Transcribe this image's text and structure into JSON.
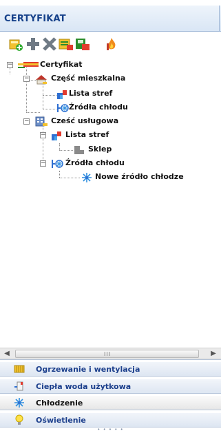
{
  "panel": {
    "title": "CERTYFIKAT"
  },
  "toolbar": {
    "buttons": [
      {
        "name": "add-item-icon"
      },
      {
        "name": "add-icon"
      },
      {
        "name": "delete-icon"
      },
      {
        "name": "edit-properties-icon"
      },
      {
        "name": "save-icon"
      },
      {
        "name": "fire-icon"
      }
    ]
  },
  "tree": {
    "root": "Certyfikat",
    "residential": "Część mieszkalna",
    "residential_zones": "Lista stref",
    "residential_cooling": "Źródła chłodu",
    "service": "Cześć usługowa",
    "service_zones": "Lista stref",
    "zone_shop": "Sklep",
    "service_cooling": "Źródła chłodu",
    "new_cooling_source": "Nowe źródło chłodze"
  },
  "scrollbar": {
    "grip": "III"
  },
  "nav": {
    "heating": "Ogrzewanie i wentylacja",
    "hot_water": "Ciepła woda użytkowa",
    "cooling": "Chłodzenie",
    "lighting": "Oświetlenie",
    "selected": "cooling"
  },
  "colors": {
    "header_text": "#16418a",
    "nav_text": "#1c3f8c"
  }
}
